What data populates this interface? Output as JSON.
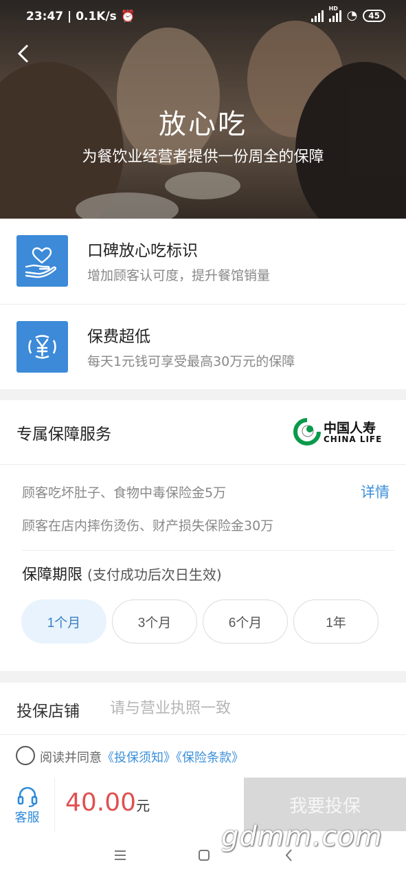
{
  "status_bar": {
    "time": "23:47",
    "speed": "0.1K/s",
    "network_label": "HD",
    "battery": "45"
  },
  "hero": {
    "title": "放心吃",
    "subtitle": "为餐饮业经营者提供一份周全的保障"
  },
  "features": [
    {
      "title": "口碑放心吃标识",
      "desc": "增加顾客认可度，提升餐馆销量",
      "icon": "heart-hand-icon"
    },
    {
      "title": "保费超低",
      "desc": "每天1元钱可享受最高30万元的保障",
      "icon": "yen-coin-icon"
    }
  ],
  "service": {
    "title": "专属保障服务",
    "logo_cn": "中国人寿",
    "logo_en": "CHINA LIFE",
    "coverage": [
      "顾客吃坏肚子、食物中毒保险金5万",
      "顾客在店内摔伤烫伤、财产损失保险金30万"
    ],
    "details_label": "详情",
    "period_label": "保障期限",
    "period_note": "(支付成功后次日生效)",
    "periods": [
      "1个月",
      "3个月",
      "6个月",
      "1年"
    ],
    "selected_period": "1个月"
  },
  "shop": {
    "label": "投保店铺",
    "placeholder": "请与营业执照一致",
    "value": ""
  },
  "agreement": {
    "prefix": "阅读并同意",
    "link1": "《投保须知》",
    "link2": "《保险条款》",
    "checked": false
  },
  "bottom": {
    "cs_label": "客服",
    "price": "40.00",
    "unit": "元",
    "buy_label": "我要投保"
  },
  "watermark": "gdmm.com",
  "colors": {
    "accent": "#3a8fd9",
    "price": "#e05050",
    "icon_bg": "#3c8ad8",
    "logo_green": "#0a9a4a"
  }
}
